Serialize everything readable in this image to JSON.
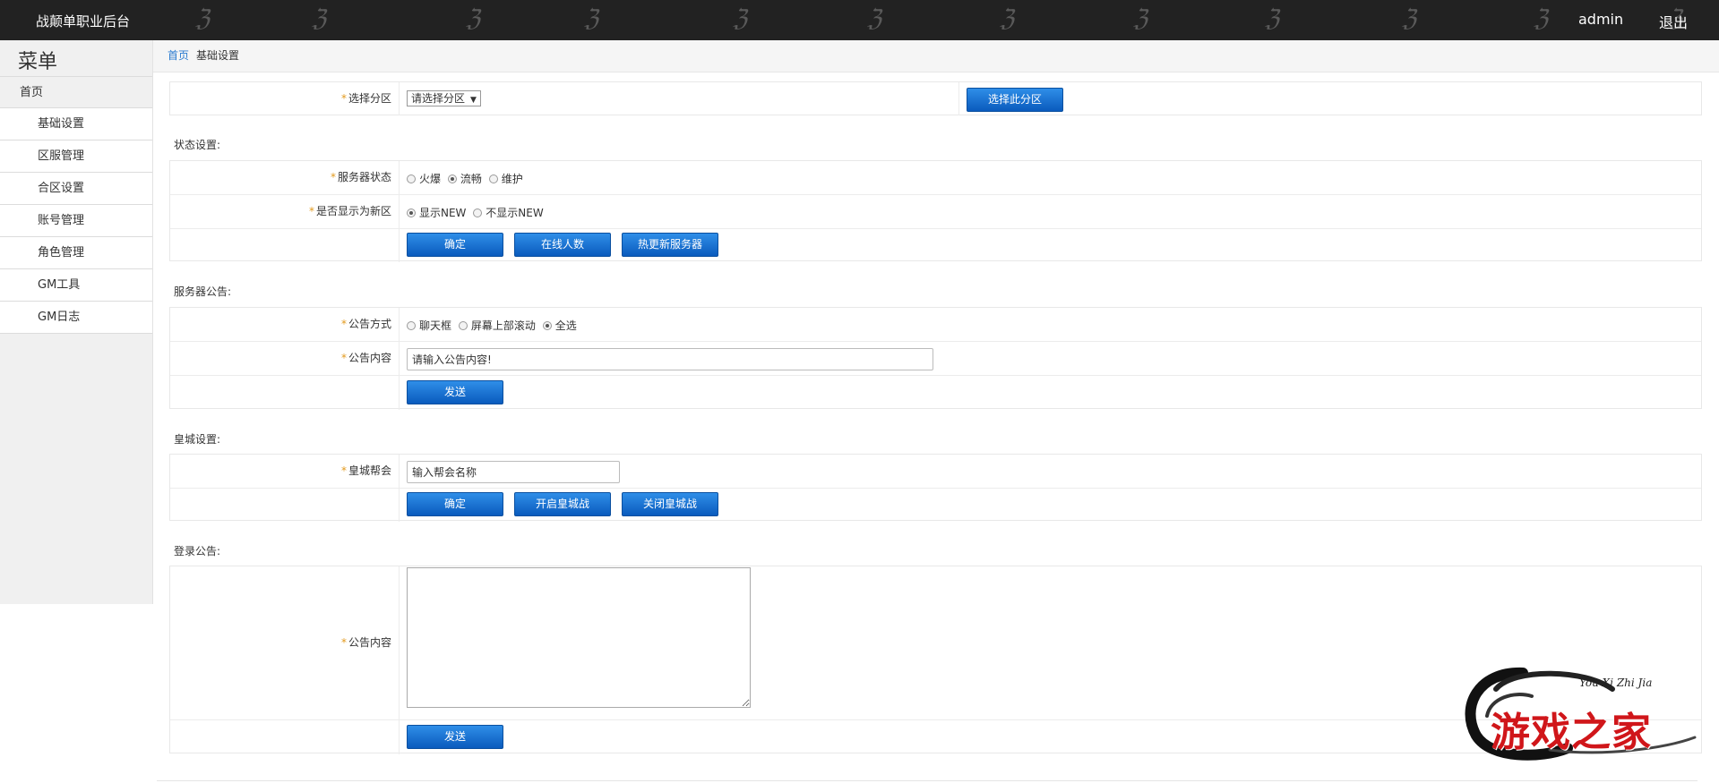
{
  "header": {
    "brand": "战颠单职业后台",
    "user": "admin",
    "logout": "退出"
  },
  "sidebar": {
    "title": "菜单",
    "home": "首页",
    "items": [
      "基础设置",
      "区服管理",
      "合区设置",
      "账号管理",
      "角色管理",
      "GM工具",
      "GM日志"
    ]
  },
  "breadcrumb": {
    "home": "首页",
    "current": "基础设置"
  },
  "zone": {
    "label": "选择分区",
    "select_value": "请选择分区",
    "select_button": "选择此分区"
  },
  "status": {
    "title": "状态设置:",
    "server_status_label": "服务器状态",
    "server_status_options": [
      "火爆",
      "流畅",
      "维护"
    ],
    "server_status_selected": 1,
    "new_label": "是否显示为新区",
    "new_options": [
      "显示NEW",
      "不显示NEW"
    ],
    "new_selected": 0,
    "buttons": [
      "确定",
      "在线人数",
      "热更新服务器"
    ]
  },
  "notice": {
    "title": "服务器公告:",
    "mode_label": "公告方式",
    "mode_options": [
      "聊天框",
      "屏幕上部滚动",
      "全选"
    ],
    "mode_selected": 2,
    "content_label": "公告内容",
    "content_value": "请输入公告内容!",
    "send": "发送"
  },
  "castle": {
    "title": "皇城设置:",
    "guild_label": "皇城帮会",
    "guild_value": "输入帮会名称",
    "buttons": [
      "确定",
      "开启皇城战",
      "关闭皇城战"
    ]
  },
  "login_notice": {
    "title": "登录公告:",
    "content_label": "公告内容",
    "send": "发送"
  },
  "logo": {
    "script": "You Xi Zhi Jia",
    "chars": "游戏之家"
  },
  "colors": {
    "topbar": "#222222",
    "button": "#1a73d3",
    "link": "#2a7bd0",
    "required": "#e39a1e",
    "logo_red": "#d0161a"
  }
}
